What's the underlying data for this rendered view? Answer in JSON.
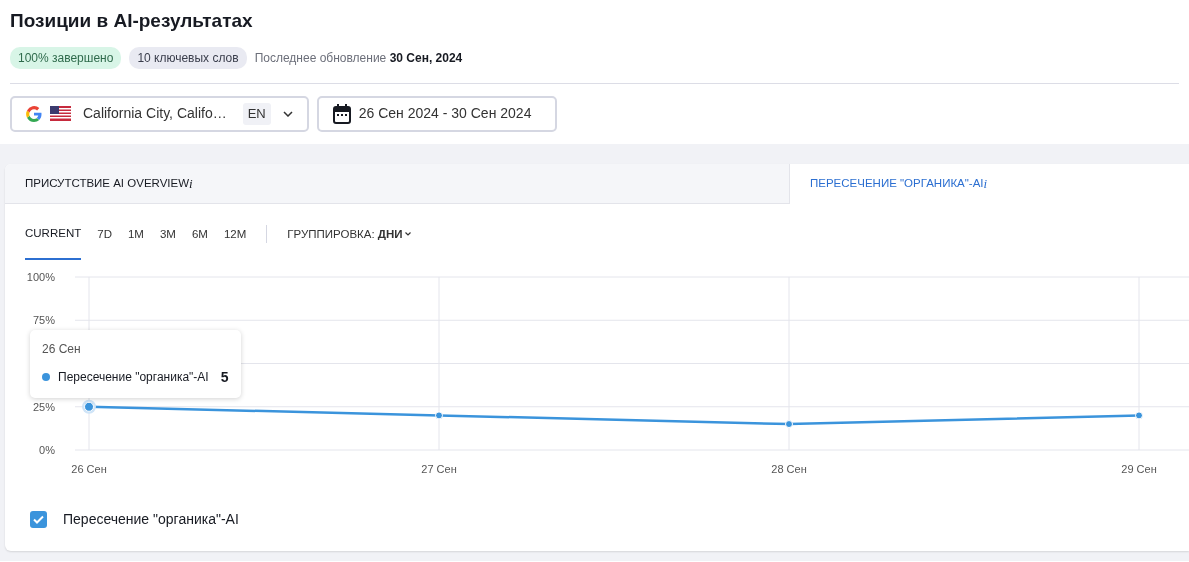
{
  "header": {
    "title": "Позиции в AI-результатах",
    "badges": [
      {
        "text": "100% завершено",
        "kind": "success"
      },
      {
        "text": "10 ключевых слов",
        "kind": "neutral"
      }
    ],
    "last_update": {
      "label": "Последнее обновление",
      "value": "30 Сен, 2024"
    }
  },
  "filters": {
    "location": "California City, Califo…",
    "language": "EN",
    "date_range": "26 Сен 2024 - 30 Сен 2024"
  },
  "section_tabs": [
    {
      "label": "ПРИСУТСТВИЕ AI OVERVIEW",
      "info": "i",
      "selected": false
    },
    {
      "label": "ПЕРЕСЕЧЕНИЕ \"ОРГАНИКА\"-AI",
      "info": "i",
      "selected": true
    }
  ],
  "periods": [
    {
      "label": "CURRENT",
      "selected": true
    },
    {
      "label": "7D",
      "selected": false
    },
    {
      "label": "1M",
      "selected": false
    },
    {
      "label": "3M",
      "selected": false
    },
    {
      "label": "6M",
      "selected": false
    },
    {
      "label": "12M",
      "selected": false
    }
  ],
  "grouping": {
    "label": "ГРУППИРОВКА:",
    "value": "ДНИ"
  },
  "chart_data": {
    "type": "line",
    "categories": [
      "26 Сен",
      "27 Сен",
      "28 Сен",
      "29 Сен"
    ],
    "series": [
      {
        "name": "Пересечение \"органика\"-AI",
        "color": "#3b94dc",
        "marker": true,
        "values": [
          25,
          20,
          15,
          20
        ]
      }
    ],
    "grid": true,
    "ylim": [
      0,
      100
    ],
    "yticks": [
      {
        "value": 0,
        "label": "0%"
      },
      {
        "value": 25,
        "label": "25%"
      },
      {
        "value": 75,
        "label": "75%"
      },
      {
        "value": 100,
        "label": "100%"
      }
    ]
  },
  "tooltip": {
    "date": "26 Сен",
    "series": "Пересечение \"органика\"-AI",
    "value": "5"
  },
  "legend": [
    {
      "checked": true
    }
  ]
}
